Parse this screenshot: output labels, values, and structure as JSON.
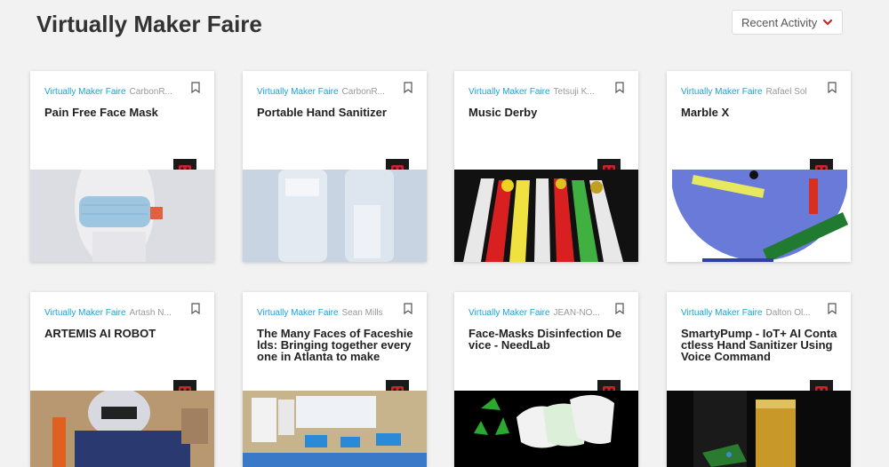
{
  "header": {
    "title": "Virtually Maker Faire",
    "sort": {
      "selected": "Recent Activity"
    }
  },
  "cards": [
    {
      "faire": "Virtually Maker Faire",
      "author": "CarbonR...",
      "title": "Pain Free Face Mask"
    },
    {
      "faire": "Virtually Maker Faire",
      "author": "CarbonR...",
      "title": "Portable Hand Sanitizer"
    },
    {
      "faire": "Virtually Maker Faire",
      "author": "Tetsuji K...",
      "title": "Music Derby"
    },
    {
      "faire": "Virtually Maker Faire",
      "author": "Rafael Sol",
      "title": "Marble X"
    },
    {
      "faire": "Virtually Maker Faire",
      "author": "Artash N...",
      "title": "ARTEMIS AI ROBOT"
    },
    {
      "faire": "Virtually Maker Faire",
      "author": "Sean Mills",
      "title": "The Many Faces of Faceshields: Bringing together everyone in Atlanta to make"
    },
    {
      "faire": "Virtually Maker Faire",
      "author": "JEAN-NO...",
      "title": "Face-Masks Disinfection Device - NeedLab"
    },
    {
      "faire": "Virtually Maker Faire",
      "author": "Dalton Ol...",
      "title": "SmartyPump - IoT+ AI Contactless Hand Sanitizer Using Voice Command"
    }
  ],
  "colors": {
    "accent": "#1aa3d6",
    "badge_red": "#d0202a",
    "chevron": "#d0202a"
  },
  "icons": {
    "bookmark": "bookmark-icon",
    "badge": "maker-faire-robot-badge-icon",
    "dropdown": "chevron-down-icon"
  }
}
